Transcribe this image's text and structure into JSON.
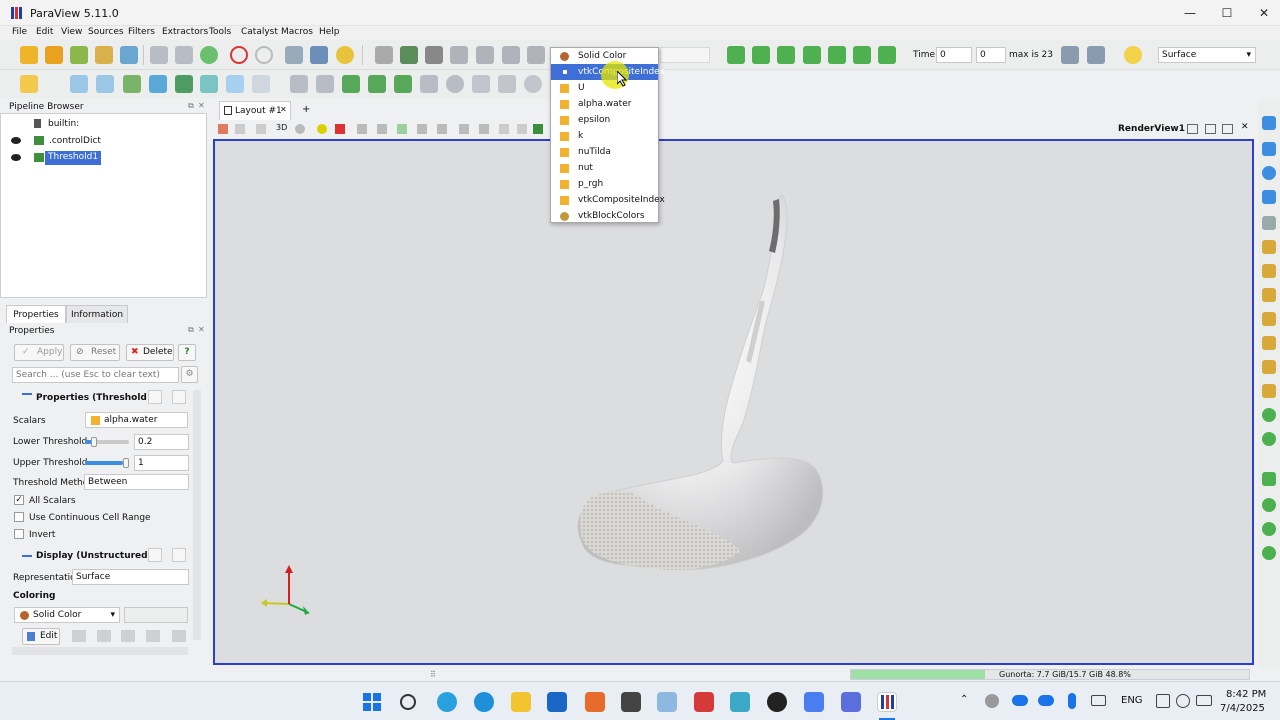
{
  "window": {
    "title": "ParaView 5.11.0",
    "minimize": "—",
    "maximize": "☐",
    "close": "✕"
  },
  "menu": [
    "File",
    "Edit",
    "View",
    "Sources",
    "Filters",
    "Extractors",
    "Tools",
    "Catalyst",
    "Macros",
    "Help"
  ],
  "toolbar": {
    "time_label": "Time:",
    "time_value": "0",
    "step_value": "0",
    "max_label": "max is 23",
    "representation": "Surface"
  },
  "coloring_dropdown": {
    "items": [
      {
        "label": "Solid Color",
        "icon": "solid-color-icon",
        "selected": false
      },
      {
        "label": "vtkCompositeIndex",
        "icon": "cell-data-icon",
        "selected": true
      },
      {
        "label": "U",
        "icon": "point-data-icon",
        "selected": false
      },
      {
        "label": "alpha.water",
        "icon": "point-data-icon",
        "selected": false
      },
      {
        "label": "epsilon",
        "icon": "point-data-icon",
        "selected": false
      },
      {
        "label": "k",
        "icon": "point-data-icon",
        "selected": false
      },
      {
        "label": "nuTilda",
        "icon": "point-data-icon",
        "selected": false
      },
      {
        "label": "nut",
        "icon": "point-data-icon",
        "selected": false
      },
      {
        "label": "p_rgh",
        "icon": "point-data-icon",
        "selected": false
      },
      {
        "label": "vtkCompositeIndex",
        "icon": "point-data-icon",
        "selected": false
      },
      {
        "label": "vtkBlockColors",
        "icon": "field-data-icon",
        "selected": false
      }
    ]
  },
  "pipeline": {
    "title": "Pipeline Browser",
    "items": [
      {
        "label": "builtin:",
        "visible": false,
        "selected": false
      },
      {
        "label": ".controlDict",
        "visible": true,
        "selected": false
      },
      {
        "label": "Threshold1",
        "visible": true,
        "selected": true
      }
    ]
  },
  "panel_tabs": [
    "Properties",
    "Information"
  ],
  "properties": {
    "title": "Properties",
    "apply": "Apply",
    "reset": "Reset",
    "delete": "Delete",
    "help": "?",
    "search_placeholder": "Search ... (use Esc to clear text)",
    "section_threshold": "Properties (Threshold",
    "scalars_label": "Scalars",
    "scalars_value": "alpha.water",
    "lower_label": "Lower Threshold",
    "lower_value": "0.2",
    "lower_fraction": 0.2,
    "upper_label": "Upper Threshold",
    "upper_value": "1",
    "upper_fraction": 1.0,
    "method_label": "Threshold Method",
    "method_value": "Between",
    "all_scalars": "All Scalars",
    "all_scalars_checked": true,
    "continuous": "Use Continuous Cell Range",
    "invert": "Invert",
    "section_display": "Display (Unstructured",
    "representation_label": "Representation",
    "representation_value": "Surface",
    "coloring_label": "Coloring",
    "coloring_value": "Solid Color",
    "edit": "Edit"
  },
  "layout": {
    "tab": "Layout #1",
    "add": "+",
    "view_name": "RenderView1",
    "view_3d": "3D"
  },
  "statusbar": {
    "memory": "Gunorta: 7.7 GiB/15.7 GiB 48.8%"
  },
  "taskbar": {
    "lang": "ENG",
    "time": "8:42 PM",
    "date": "7/4/2025"
  },
  "colors": {
    "accent": "#2c3fd0",
    "selection": "#3d6fd6",
    "cursor_highlight": "#e6e600",
    "axis_x": "#21a83a",
    "axis_y": "#c8c81e",
    "axis_z": "#d42020"
  }
}
